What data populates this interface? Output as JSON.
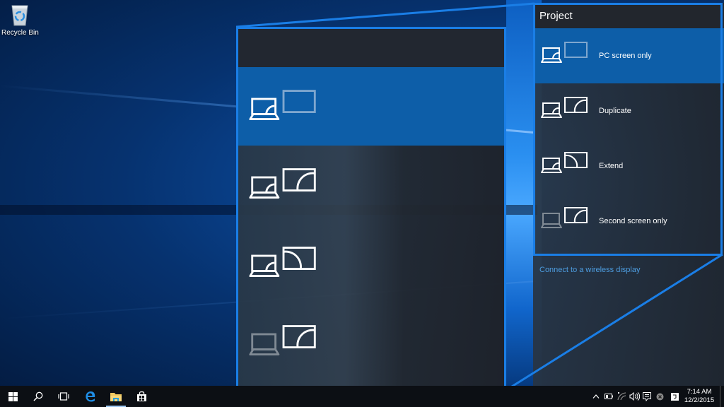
{
  "desktop": {
    "icons": [
      {
        "label": "Recycle Bin",
        "icon": "recycle-bin-icon"
      }
    ]
  },
  "project_flyout": {
    "title": "Project",
    "options": [
      {
        "label": "PC screen only",
        "icon": "pc-screen-only-icon",
        "selected": true
      },
      {
        "label": "Duplicate",
        "icon": "duplicate-icon",
        "selected": false
      },
      {
        "label": "Extend",
        "icon": "extend-icon",
        "selected": false
      },
      {
        "label": "Second screen only",
        "icon": "second-screen-only-icon",
        "selected": false
      }
    ],
    "connect_link": "Connect to a wireless display"
  },
  "taskbar": {
    "buttons": [
      {
        "name": "start",
        "icon": "windows-logo-icon"
      },
      {
        "name": "search",
        "icon": "search-icon"
      },
      {
        "name": "task-view",
        "icon": "task-view-icon"
      },
      {
        "name": "edge",
        "icon": "edge-browser-icon"
      },
      {
        "name": "file-explorer",
        "icon": "folder-icon",
        "active": true
      },
      {
        "name": "store",
        "icon": "store-icon"
      }
    ],
    "tray": [
      "chevron-up-icon",
      "battery-icon",
      "wifi-icon",
      "volume-icon",
      "action-center-icon",
      "close-circle-icon",
      "notes-icon"
    ],
    "clock": {
      "time": "7:14 AM",
      "date": "12/2/2015"
    }
  },
  "colors": {
    "accent": "#1a7ee6",
    "selected_bg": "#0d5ea8",
    "link": "#4d9de0",
    "taskbar_bg": "#0c0f14"
  }
}
